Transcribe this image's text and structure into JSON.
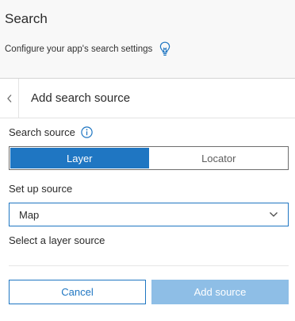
{
  "header": {
    "title": "Search",
    "subtitle": "Configure your app's search settings",
    "tip_icon": "lightbulb-icon"
  },
  "panel": {
    "back_icon": "chevron-left-icon",
    "title": "Add search source"
  },
  "search_source": {
    "label": "Search source",
    "info_icon": "info-icon",
    "options": [
      "Layer",
      "Locator"
    ],
    "selected": "Layer"
  },
  "setup": {
    "label": "Set up source",
    "select_value": "Map",
    "layer_label": "Select a layer source"
  },
  "actions": {
    "cancel_label": "Cancel",
    "add_label": "Add source"
  },
  "colors": {
    "accent": "#1f76c2",
    "accent_disabled": "#8ebee6",
    "background": "#f8f8f8",
    "panel": "#ffffff"
  }
}
